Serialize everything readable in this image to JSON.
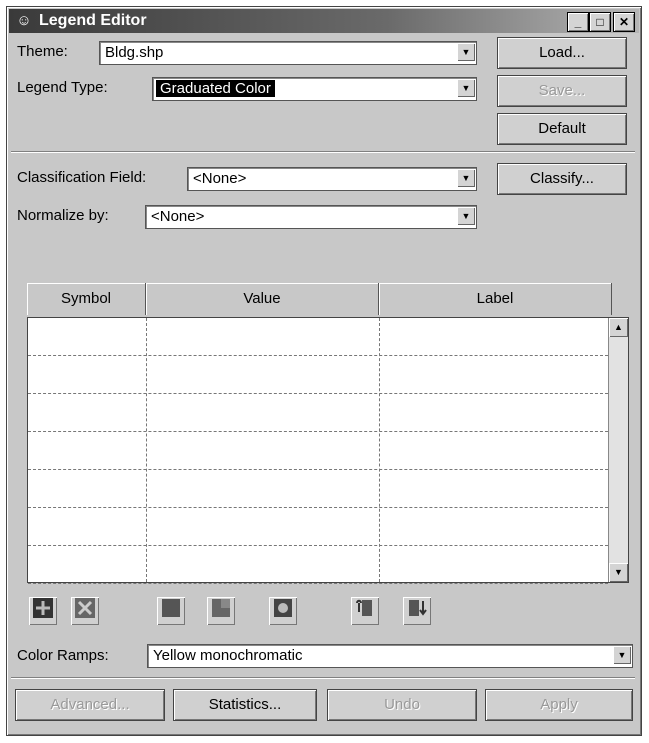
{
  "window": {
    "title": "Legend Editor",
    "icon": "legend-icon"
  },
  "theme": {
    "label": "Theme:",
    "value": "Bldg.shp"
  },
  "legend_type": {
    "label": "Legend Type:",
    "value": "Graduated Color"
  },
  "buttons": {
    "load": "Load...",
    "save": "Save...",
    "default": "Default",
    "classify": "Classify..."
  },
  "classification": {
    "label": "Classification Field:",
    "value": "<None>"
  },
  "normalize": {
    "label": "Normalize by:",
    "value": "<None>"
  },
  "table": {
    "columns": [
      "Symbol",
      "Value",
      "Label"
    ],
    "rows": 7
  },
  "toolbar_icons": [
    "add-class-icon",
    "delete-class-icon",
    "stat-icon-1",
    "stat-icon-2",
    "stat-icon-3",
    "flip-symbols-icon",
    "sort-icon"
  ],
  "color_ramps": {
    "label": "Color Ramps:",
    "value": "Yellow monochromatic"
  },
  "bottom_buttons": {
    "advanced": "Advanced...",
    "statistics": "Statistics...",
    "undo": "Undo",
    "apply": "Apply"
  }
}
